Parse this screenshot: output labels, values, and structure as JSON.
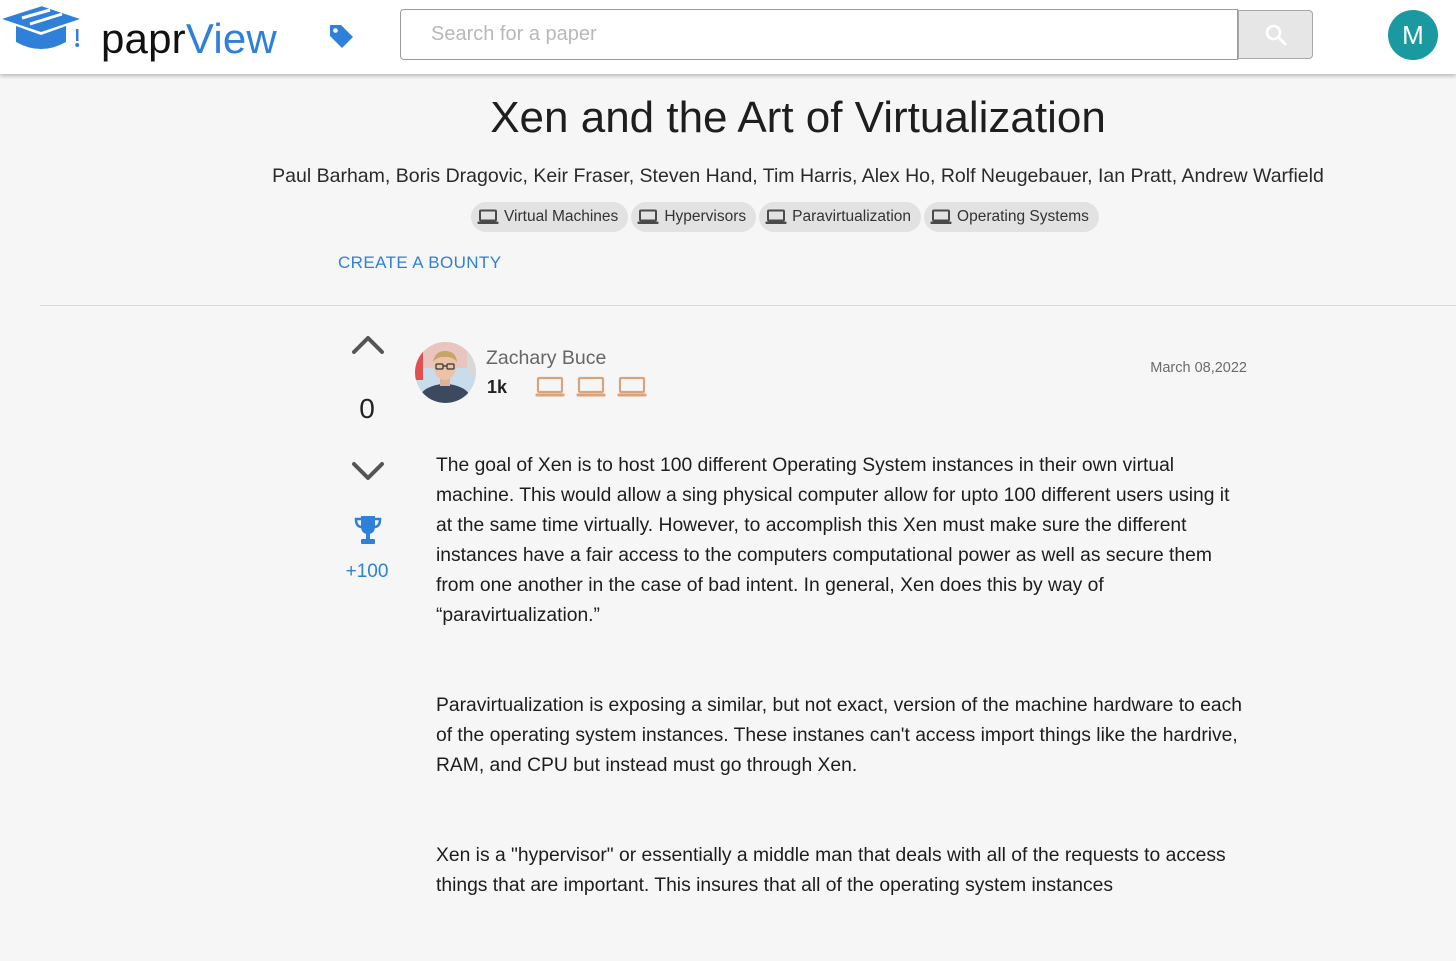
{
  "header": {
    "brand_part1": "papr",
    "brand_part2": "View",
    "search_placeholder": "Search for a paper",
    "user_initial": "M",
    "accent_color": "#2f80d9",
    "avatar_color": "#1a9aa0"
  },
  "paper": {
    "title": "Xen and the Art of Virtualization",
    "authors": "Paul Barham, Boris Dragovic, Keir Fraser, Steven Hand, Tim Harris, Alex Ho, Rolf Neugebauer, Ian Pratt, Andrew Warfield",
    "tags": [
      {
        "label": "Virtual Machines",
        "icon": "laptop-icon"
      },
      {
        "label": "Hypervisors",
        "icon": "laptop-icon"
      },
      {
        "label": "Paravirtualization",
        "icon": "laptop-icon"
      },
      {
        "label": "Operating Systems",
        "icon": "laptop-icon"
      }
    ],
    "create_bounty_label": "CREATE A BOUNTY"
  },
  "post": {
    "votes": "0",
    "bounty": "+100",
    "author": "Zachary Buce",
    "reputation": "1k",
    "badges": [
      "laptop-icon",
      "laptop-icon",
      "laptop-icon"
    ],
    "date": "March 08,2022",
    "paragraphs": [
      "The goal of Xen is to host 100 different Operating System instances in their own virtual machine. This would allow a sing physical computer allow for upto 100 different users using it at the same time virtually. However, to accomplish this Xen must make sure the different instances have a fair access to the computers computational power as well as secure them from one another in the case of bad intent. In general, Xen does this by way of “paravirtualization.”",
      "Paravirtualization is exposing a similar, but not exact, version of the machine hardware to each of the operating system instances. These instanes can't access import things like the hardrive, RAM, and CPU but instead must go through Xen.",
      "Xen is a \"hypervisor\" or essentially a middle man that deals with all of the requests to access things that are important. This insures that all of the operating system instances"
    ]
  }
}
